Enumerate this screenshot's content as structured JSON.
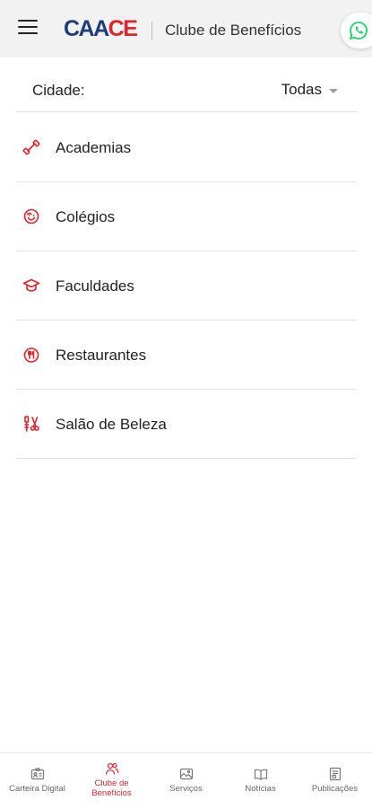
{
  "header": {
    "logo_part1": "CAA",
    "logo_part2": "CE",
    "title": "Clube de Benefícios",
    "menu_icon": "menu-icon",
    "whatsapp_icon": "whatsapp-icon"
  },
  "filter": {
    "label": "Cidade:",
    "selected": "Todas"
  },
  "categories": [
    {
      "label": "Academias",
      "icon": "dumbbell-icon"
    },
    {
      "label": "Colégios",
      "icon": "smile-icon"
    },
    {
      "label": "Faculdades",
      "icon": "graduation-cap-icon"
    },
    {
      "label": "Restaurantes",
      "icon": "restaurant-icon"
    },
    {
      "label": "Salão de Beleza",
      "icon": "beauty-salon-icon"
    }
  ],
  "bottom_nav": [
    {
      "label": "Carteira Digital",
      "icon": "id-card-icon",
      "active": false
    },
    {
      "label": "Clube de Benefícios",
      "icon": "group-icon",
      "active": true
    },
    {
      "label": "Serviços",
      "icon": "services-icon",
      "active": false
    },
    {
      "label": "Notícias",
      "icon": "news-icon",
      "active": false
    },
    {
      "label": "Publicações",
      "icon": "publications-icon",
      "active": false
    }
  ],
  "colors": {
    "accent": "#e1232b",
    "brand_blue": "#1f3d7a",
    "header_bg": "#f2f2f2",
    "whatsapp": "#25d366"
  }
}
